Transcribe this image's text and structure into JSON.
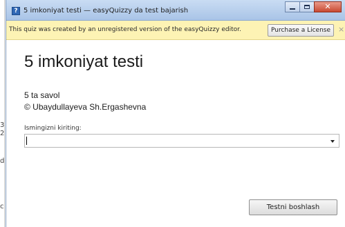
{
  "window": {
    "title": "5 imkoniyat testi — easyQuizzy da test bajarish",
    "app_icon_glyph": "?"
  },
  "banner": {
    "message": "This quiz was created by an unregistered version of the easyQuizzy editor.",
    "license_button": "Purchase a License",
    "close_glyph": "×"
  },
  "quiz": {
    "title": "5 imkoniyat testi",
    "question_count": "5 ta savol",
    "author": "© Ubaydullayeva Sh.Ergashevna"
  },
  "name_field": {
    "label": "Ismingizni kiriting:",
    "value": ""
  },
  "start_button": "Testni boshlash",
  "background_doc": {
    "chars": [
      "3",
      "2",
      "d",
      "c"
    ]
  },
  "colors": {
    "banner_bg": "#fdf3b4",
    "titlebar": "#b8cfee",
    "close_button": "#c94a32"
  }
}
